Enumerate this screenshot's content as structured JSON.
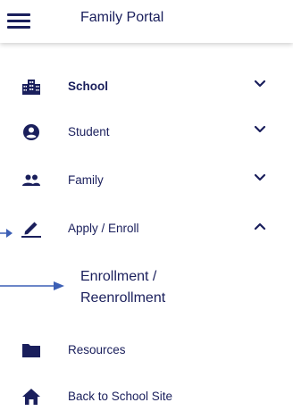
{
  "header": {
    "title": "Family Portal",
    "menu_icon": "hamburger-menu-icon"
  },
  "nav": {
    "school": {
      "label": "School",
      "icon": "school-building-icon",
      "expanded": false
    },
    "student": {
      "label": "Student",
      "icon": "account-circle-icon",
      "expanded": false
    },
    "family": {
      "label": "Family",
      "icon": "people-icon",
      "expanded": false
    },
    "apply": {
      "label": "Apply / Enroll",
      "icon": "pencil-edit-icon",
      "expanded": true
    },
    "apply_sub": {
      "line1": "Enrollment /",
      "line2": "Reenrollment"
    },
    "resources": {
      "label": "Resources",
      "icon": "folder-icon"
    },
    "back": {
      "label": "Back to School Site",
      "icon": "home-icon"
    }
  },
  "colors": {
    "primary": "#1a1f5c",
    "annotation_arrow": "#3c5fb5"
  }
}
